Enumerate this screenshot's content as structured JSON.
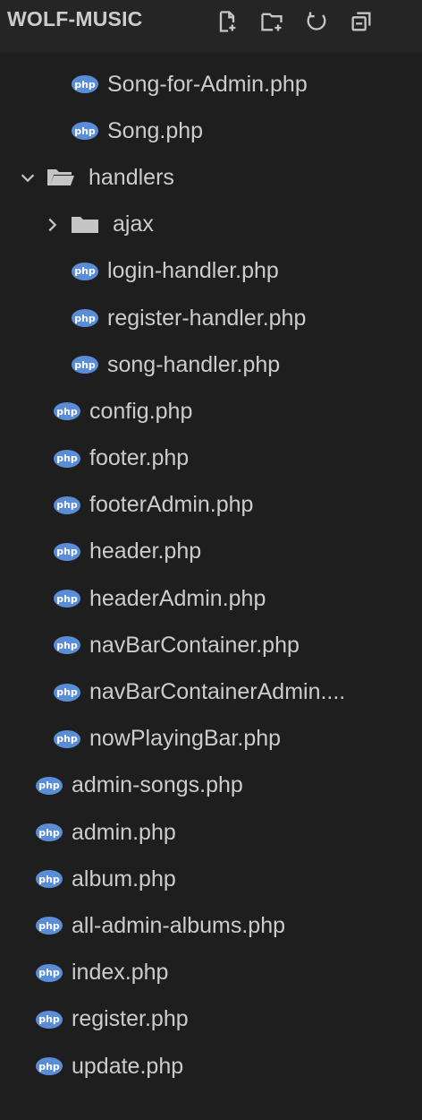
{
  "explorer": {
    "folder_title": "WOLF-MUSIC",
    "actions": [
      {
        "name": "new-file-icon"
      },
      {
        "name": "new-folder-icon"
      },
      {
        "name": "refresh-icon"
      },
      {
        "name": "collapse-all-icon"
      }
    ]
  },
  "colors": {
    "background": "#1e1e1e",
    "php_icon": "#5a8dd8",
    "folder_icon": "#c5c5c5",
    "text": "#cccccc"
  },
  "icon_text": "php",
  "tree": [
    {
      "label": "Song-for-Admin.php",
      "kind": "php-file"
    },
    {
      "label": "Song.php",
      "kind": "php-file"
    },
    {
      "label": "handlers",
      "kind": "folder",
      "expanded": true
    },
    {
      "label": "ajax",
      "kind": "folder",
      "expanded": false
    },
    {
      "label": "login-handler.php",
      "kind": "php-file"
    },
    {
      "label": "register-handler.php",
      "kind": "php-file"
    },
    {
      "label": "song-handler.php",
      "kind": "php-file"
    },
    {
      "label": "config.php",
      "kind": "php-file"
    },
    {
      "label": "footer.php",
      "kind": "php-file"
    },
    {
      "label": "footerAdmin.php",
      "kind": "php-file"
    },
    {
      "label": "header.php",
      "kind": "php-file"
    },
    {
      "label": "headerAdmin.php",
      "kind": "php-file"
    },
    {
      "label": "navBarContainer.php",
      "kind": "php-file"
    },
    {
      "label": "navBarContainerAdmin....",
      "kind": "php-file"
    },
    {
      "label": "nowPlayingBar.php",
      "kind": "php-file"
    },
    {
      "label": "admin-songs.php",
      "kind": "php-file"
    },
    {
      "label": "admin.php",
      "kind": "php-file"
    },
    {
      "label": "album.php",
      "kind": "php-file"
    },
    {
      "label": "all-admin-albums.php",
      "kind": "php-file"
    },
    {
      "label": "index.php",
      "kind": "php-file"
    },
    {
      "label": "register.php",
      "kind": "php-file"
    },
    {
      "label": "update.php",
      "kind": "php-file"
    }
  ]
}
